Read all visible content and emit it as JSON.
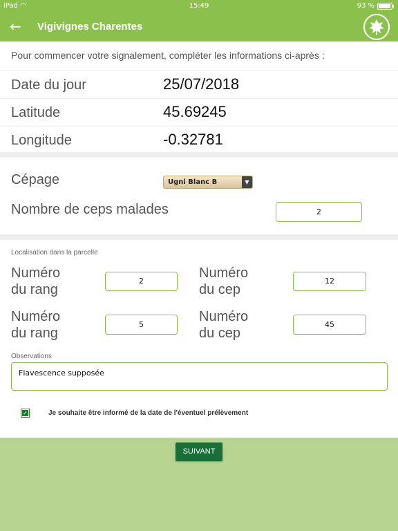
{
  "status": {
    "device": "iPad",
    "time": "15:49",
    "battery": "93 %",
    "battery_level": 0.93
  },
  "header": {
    "title": "Vigivignes Charentes",
    "back_icon": "arrow-left-icon",
    "logo_icon": "vine-leaf-logo-icon"
  },
  "intro": "Pour commencer votre signalement, compléter les informations ci-après :",
  "info": {
    "date_label": "Date du jour",
    "date_value": "25/07/2018",
    "lat_label": "Latitude",
    "lat_value": "45.69245",
    "lon_label": "Longitude",
    "lon_value": "-0.32781"
  },
  "cepage": {
    "label": "Cépage",
    "selected": "Ugni Blanc B"
  },
  "ceps_malades": {
    "label": "Nombre de ceps malades",
    "value": "2"
  },
  "localisation": {
    "label": "Localisation dans la parcelle",
    "rang_label_1": "Numéro",
    "rang_label_2": "du rang",
    "cep_label_1": "Numéro",
    "cep_label_2": "du cep",
    "row1": {
      "rang": "2",
      "cep": "12"
    },
    "row2": {
      "rang": "5",
      "cep": "45"
    }
  },
  "observations": {
    "label": "Observations",
    "value": "Flavescence supposée"
  },
  "notify": {
    "checked": true,
    "label": "Je souhaite être informé de la date de l'éventuel prélèvement"
  },
  "next_button": "SUIVANT",
  "colors": {
    "accent": "#8cc04c",
    "footer": "#b6d48f",
    "button": "#1a6e38"
  }
}
